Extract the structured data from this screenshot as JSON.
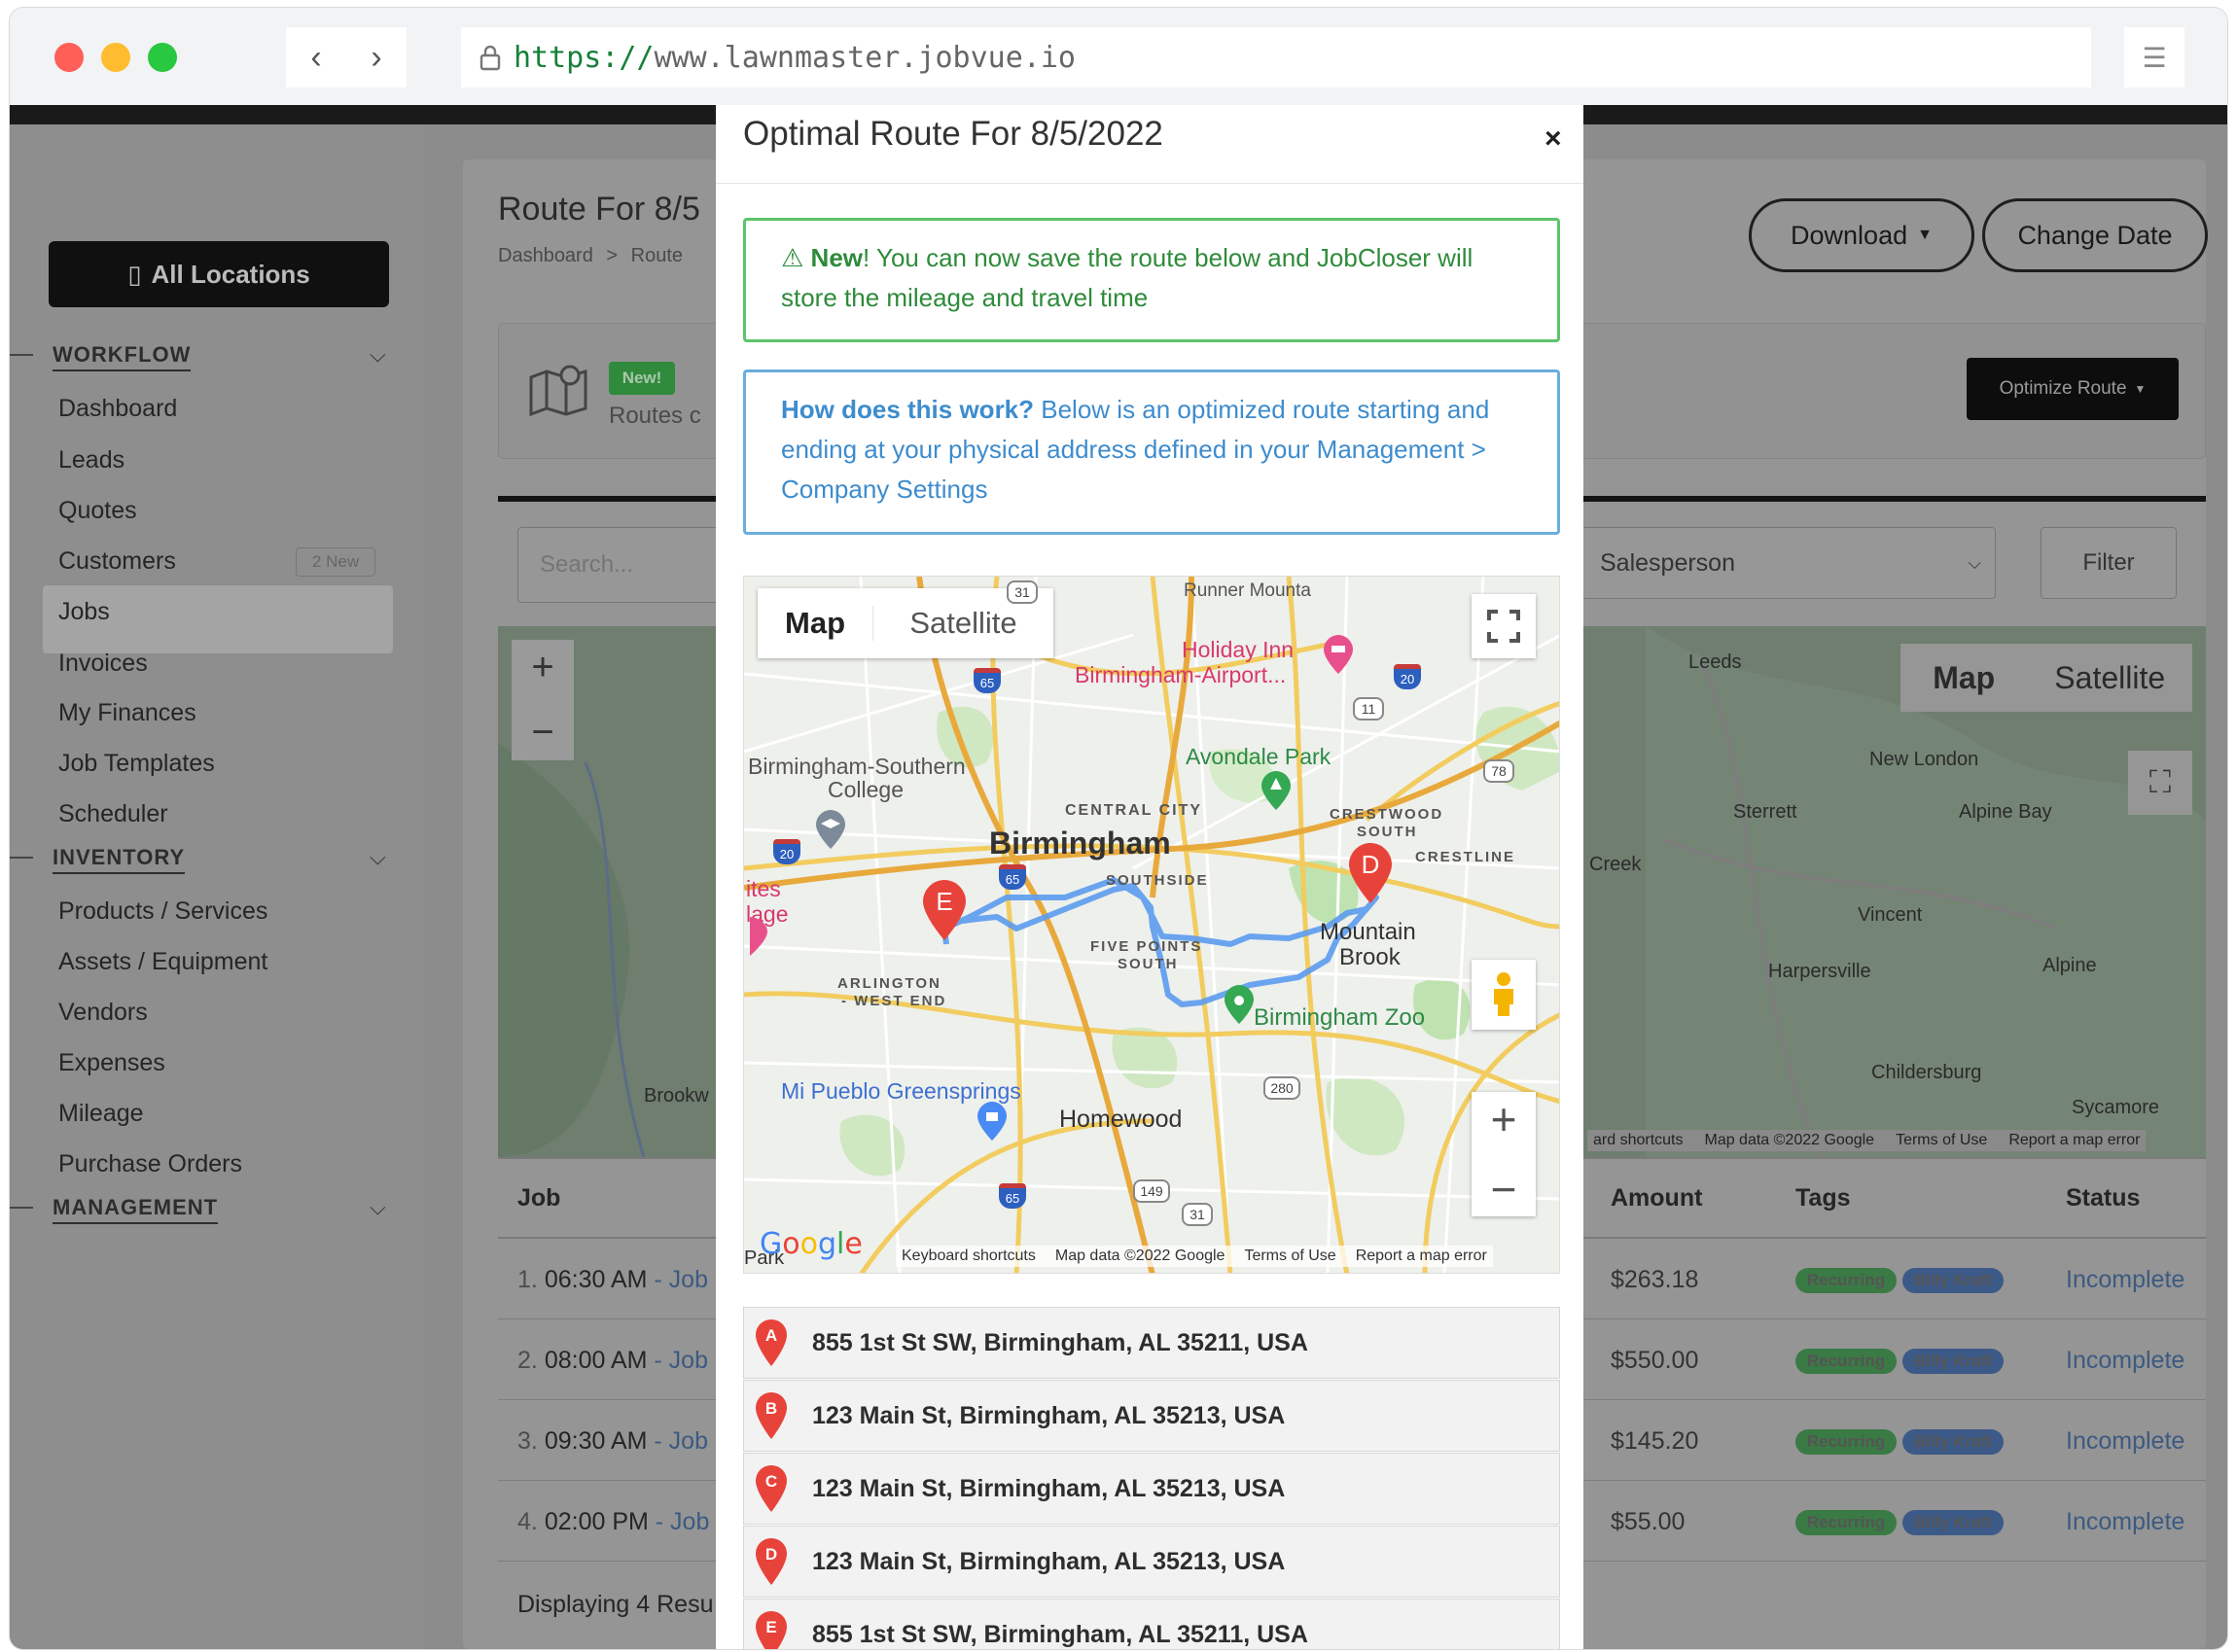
{
  "browser": {
    "url_scheme": "https://",
    "url_host": "www.lawnmaster.jobvue.io",
    "back_icon": "chevron-left-icon",
    "forward_icon": "chevron-right-icon"
  },
  "sidebar": {
    "all_locations": "All Locations",
    "sections": [
      {
        "label": "WORKFLOW"
      },
      {
        "label": "INVENTORY"
      },
      {
        "label": "MANAGEMENT"
      }
    ],
    "items": [
      {
        "label": "Dashboard"
      },
      {
        "label": "Leads"
      },
      {
        "label": "Quotes"
      },
      {
        "label": "Customers",
        "badge": "2 New"
      },
      {
        "label": "Jobs"
      },
      {
        "label": "Invoices"
      },
      {
        "label": "My Finances"
      },
      {
        "label": "Job Templates"
      },
      {
        "label": "Scheduler"
      },
      {
        "label": "Products / Services"
      },
      {
        "label": "Assets / Equipment"
      },
      {
        "label": "Vendors"
      },
      {
        "label": "Expenses"
      },
      {
        "label": "Mileage"
      },
      {
        "label": "Purchase Orders"
      }
    ]
  },
  "page": {
    "title": "Route For 8/5",
    "breadcrumb": [
      "Dashboard",
      ">",
      "Route"
    ],
    "download": "Download",
    "change_date": "Change Date",
    "banner_new": "New!",
    "banner_text": "Routes c",
    "optimize_route": "Optimize Route",
    "search_placeholder": "Search...",
    "salesperson": "Salesperson",
    "filter": "Filter",
    "bg_map": {
      "map_tab": "Map",
      "satellite_tab": "Satellite",
      "labels": [
        "Leeds",
        "New London",
        "Sterrett",
        "Alpine Bay",
        "Creek",
        "Vincent",
        "Harpersville",
        "Alpine",
        "Childersburg",
        "Sycamore",
        "Brookw"
      ],
      "footer": [
        "ard shortcuts",
        "Map data ©2022 Google",
        "Terms of Use",
        "Report a map error"
      ]
    },
    "table": {
      "headers": {
        "job": "Job",
        "amount": "Amount",
        "tags": "Tags",
        "status": "Status"
      },
      "rows": [
        {
          "num": "1.",
          "time": "06:30 AM",
          "job": "- Job",
          "amount": "$263.18",
          "tag1": "Recurring",
          "tag2": "Billy Kraft",
          "status": "Incomplete"
        },
        {
          "num": "2.",
          "time": "08:00 AM",
          "job": "- Job",
          "amount": "$550.00",
          "tag1": "Recurring",
          "tag2": "Billy Kraft",
          "status": "Incomplete"
        },
        {
          "num": "3.",
          "time": "09:30 AM",
          "job": "- Job",
          "amount": "$145.20",
          "tag1": "Recurring",
          "tag2": "Billy Kraft",
          "status": "Incomplete"
        },
        {
          "num": "4.",
          "time": "02:00 PM",
          "job": "- Job",
          "amount": "$55.00",
          "tag1": "Recurring",
          "tag2": "Billy Kraft",
          "status": "Incomplete"
        }
      ],
      "footer": "Displaying 4 Resu"
    }
  },
  "modal": {
    "title": "Optimal Route For 8/5/2022",
    "close": "×",
    "alert_new_strong": "New",
    "alert_new_text": "! You can now save the route below and JobCloser will store the mileage and travel time",
    "alert_how_strong": "How does this work?",
    "alert_how_text": " Below is an optimized route starting and ending at your physical address defined in your Management > Company Settings",
    "map": {
      "map_tab": "Map",
      "satellite_tab": "Satellite",
      "labels": {
        "holiday_inn": "Holiday Inn",
        "bham_airport": "Birmingham-Airport...",
        "avondale": "Avondale Park",
        "bsc": "Birmingham-Southern",
        "college": "College",
        "central_city": "CENTRAL CITY",
        "birmingham": "Birmingham",
        "crestwood": "CRESTWOOD",
        "south": "SOUTH",
        "crestline": "CRESTLINE",
        "southside": "SOUTHSIDE",
        "five_points": "FIVE POINTS",
        "five_points_south": "SOUTH",
        "arlington": "ARLINGTON",
        "west_end": "- WEST END",
        "mountain": "Mountain",
        "brook": "Brook",
        "zoo": "Birmingham Zoo",
        "mi_pueblo": "Mi Pueblo Greensprings",
        "homewood": "Homewood",
        "ites": "ites",
        "lage": "lage",
        "park": "Park",
        "top_cut": "Runner Mounta"
      },
      "shields": [
        "31",
        "65",
        "20",
        "11",
        "78",
        "20",
        "65",
        "280",
        "149",
        "31",
        "65"
      ],
      "markers": [
        "E",
        "D"
      ],
      "footer": [
        "Keyboard shortcuts",
        "Map data ©2022 Google",
        "Terms of Use",
        "Report a map error"
      ]
    },
    "stops": [
      {
        "letter": "A",
        "address": "855 1st St SW, Birmingham, AL 35211, USA"
      },
      {
        "letter": "B",
        "address": "123 Main St, Birmingham, AL 35213, USA"
      },
      {
        "letter": "C",
        "address": "123 Main St, Birmingham, AL 35213, USA"
      },
      {
        "letter": "D",
        "address": "123 Main St, Birmingham, AL 35213, USA"
      },
      {
        "letter": "E",
        "address": "855 1st St SW, Birmingham, AL 35211, USA"
      }
    ]
  },
  "colors": {
    "alert_green": "#2e8b3a",
    "alert_blue": "#3d8ccd",
    "route_blue": "#5b9bf0",
    "marker_red": "#e8433a"
  }
}
